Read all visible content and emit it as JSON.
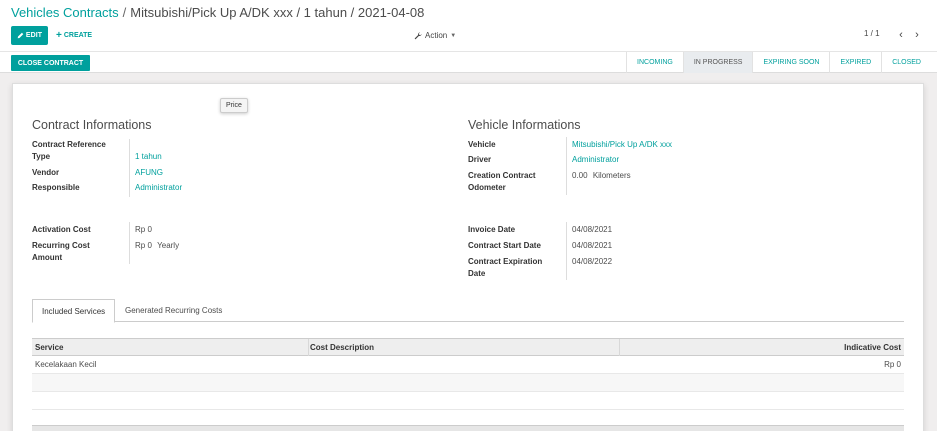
{
  "breadcrumb": {
    "parent": "Vehicles Contracts",
    "separator": "/",
    "current": "Mitsubishi/Pick Up A/DK xxx / 1 tahun / 2021-04-08"
  },
  "toolbar": {
    "edit_label": "EDIT",
    "create_label": "CREATE",
    "action_label": "Action",
    "pager": "1 / 1"
  },
  "statusbar": {
    "close_label": "CLOSE CONTRACT",
    "stages": [
      "INCOMING",
      "IN PROGRESS",
      "EXPIRING SOON",
      "EXPIRED",
      "CLOSED"
    ],
    "active_stage": "IN PROGRESS"
  },
  "tooltip": "Price",
  "contract": {
    "title": "Contract Informations",
    "type_label": "Contract Reference Type",
    "type_value": "1 tahun",
    "vendor_label": "Vendor",
    "vendor_value": "AFUNG",
    "responsible_label": "Responsible",
    "responsible_value": "Administrator",
    "activation_label": "Activation Cost",
    "activation_value": "Rp 0",
    "recurring_label": "Recurring Cost Amount",
    "recurring_value": "Rp 0",
    "recurring_period": "Yearly"
  },
  "vehicle": {
    "title": "Vehicle Informations",
    "vehicle_label": "Vehicle",
    "vehicle_value": "Mitsubishi/Pick Up A/DK xxx",
    "driver_label": "Driver",
    "driver_value": "Administrator",
    "odometer_label": "Creation Contract Odometer",
    "odometer_value": "0.00",
    "odometer_unit": "Kilometers",
    "invoice_label": "Invoice Date",
    "invoice_value": "04/08/2021",
    "start_label": "Contract Start Date",
    "start_value": "04/08/2021",
    "expiration_label": "Contract Expiration Date",
    "expiration_value": "04/08/2022"
  },
  "tabs": [
    "Included Services",
    "Generated Recurring Costs"
  ],
  "table": {
    "columns": [
      "Service",
      "Cost Description",
      "Indicative Cost"
    ],
    "rows": [
      {
        "service": "Kecelakaan Kecil",
        "description": "",
        "cost": "Rp 0"
      }
    ]
  },
  "colors": {
    "accent": "#00a09d",
    "text": "#4c4c4c"
  }
}
